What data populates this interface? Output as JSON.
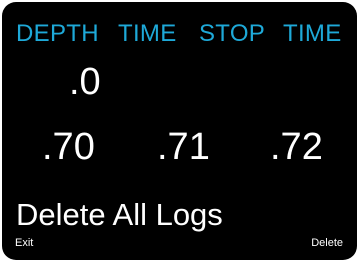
{
  "header": {
    "col1": "DEPTH",
    "col2": "TIME",
    "col3": "STOP",
    "col4": "TIME"
  },
  "values": {
    "depth": ".0",
    "row": [
      ".70",
      ".71",
      ".72"
    ]
  },
  "message": "Delete All Logs",
  "softkeys": {
    "left": "Exit",
    "right": "Delete"
  },
  "colors": {
    "header_text": "#1ea9d8",
    "background": "#000000",
    "text": "#ffffff"
  }
}
